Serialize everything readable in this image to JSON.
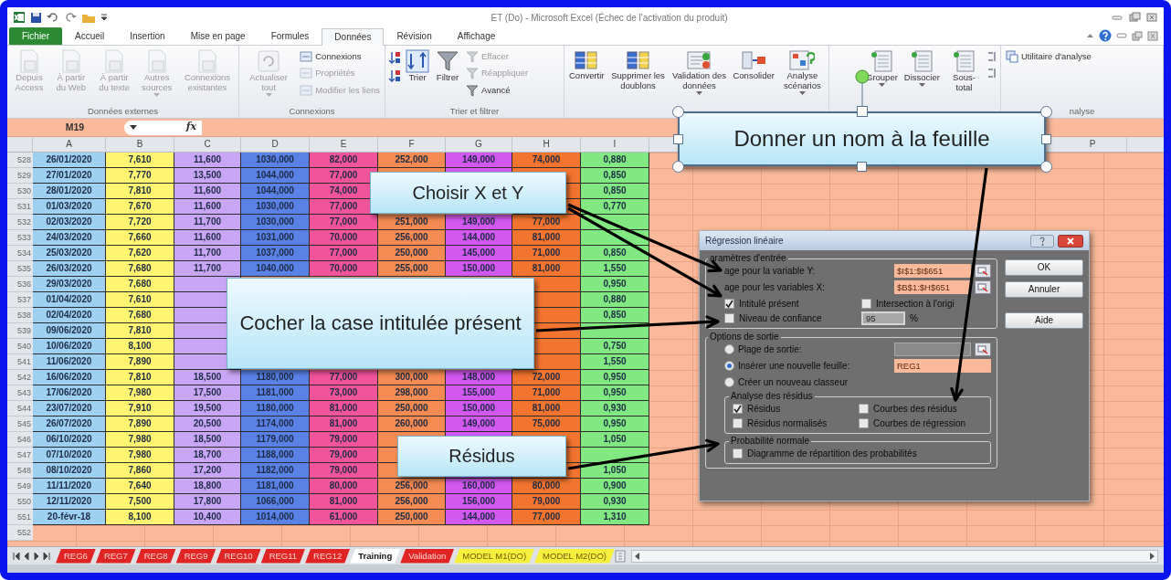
{
  "window": {
    "title": "ET (Do)  -  Microsoft Excel (Échec de l'activation du produit)"
  },
  "ribbon_tabs": [
    {
      "label": "Fichier",
      "kind": "file",
      "selected": false
    },
    {
      "label": "Accueil",
      "kind": "tab",
      "selected": false
    },
    {
      "label": "Insertion",
      "kind": "tab",
      "selected": false
    },
    {
      "label": "Mise en page",
      "kind": "tab",
      "selected": false
    },
    {
      "label": "Formules",
      "kind": "tab",
      "selected": false
    },
    {
      "label": "Données",
      "kind": "tab",
      "selected": true
    },
    {
      "label": "Révision",
      "kind": "tab",
      "selected": false
    },
    {
      "label": "Affichage",
      "kind": "tab",
      "selected": false
    }
  ],
  "ribbon_groups": [
    {
      "label": "Données externes",
      "buttons": [
        {
          "kind": "large",
          "label": "Depuis Access",
          "disabled": true
        },
        {
          "kind": "large",
          "label": "À partir du Web",
          "disabled": true
        },
        {
          "kind": "large",
          "label": "À partir du texte",
          "disabled": true
        },
        {
          "kind": "large",
          "label": "Autres sources",
          "disabled": true,
          "dropdown": true
        },
        {
          "kind": "large",
          "label": "Connexions existantes",
          "disabled": true
        }
      ]
    },
    {
      "label": "Connexions",
      "buttons": [
        {
          "kind": "large",
          "label": "Actualiser tout",
          "disabled": true,
          "dropdown": true
        },
        {
          "kind": "small",
          "label": "Connexions",
          "disabled": false
        },
        {
          "kind": "small",
          "label": "Propriétés",
          "disabled": true
        },
        {
          "kind": "small",
          "label": "Modifier les liens",
          "disabled": true
        }
      ]
    },
    {
      "label": "Trier et filtrer",
      "buttons": [
        {
          "kind": "icon",
          "disabled": false
        },
        {
          "kind": "icon",
          "disabled": false
        },
        {
          "kind": "large",
          "label": "Trier",
          "disabled": false
        },
        {
          "kind": "large",
          "label": "Filtrer",
          "disabled": false
        },
        {
          "kind": "small",
          "label": "Effacer",
          "disabled": true
        },
        {
          "kind": "small",
          "label": "Réappliquer",
          "disabled": true
        },
        {
          "kind": "small",
          "label": "Avancé",
          "disabled": false
        }
      ]
    },
    {
      "buttons": [
        {
          "kind": "large",
          "label": "Convertir",
          "disabled": false
        },
        {
          "kind": "large",
          "label": "Supprimer les doublons",
          "disabled": false
        },
        {
          "kind": "large",
          "label": "Validation des données",
          "disabled": false,
          "dropdown": true
        },
        {
          "kind": "large",
          "label": "Consolider",
          "disabled": false
        },
        {
          "kind": "large",
          "label": "Analyse scénarios",
          "disabled": false,
          "dropdown": true
        }
      ]
    },
    {
      "buttons": [
        {
          "kind": "large",
          "label": "Grouper",
          "disabled": false,
          "dropdown": true
        },
        {
          "kind": "large",
          "label": "Dissocier",
          "disabled": false,
          "dropdown": true
        },
        {
          "kind": "large",
          "label": "Sous-total",
          "disabled": false
        },
        {
          "kind": "icon",
          "disabled": false
        },
        {
          "kind": "icon",
          "disabled": false
        }
      ]
    },
    {
      "label": "nalyse",
      "buttons": [
        {
          "kind": "small",
          "label": "Utilitaire d'analyse",
          "disabled": false
        }
      ]
    }
  ],
  "formula_bar": {
    "name_box": "M19",
    "function_label": "fx"
  },
  "sheet": {
    "columns": [
      {
        "header": "A",
        "color": "#9ed0f2"
      },
      {
        "header": "B",
        "color": "#fff570"
      },
      {
        "header": "C",
        "color": "#c9a6f5"
      },
      {
        "header": "D",
        "color": "#5a82e6"
      },
      {
        "header": "E",
        "color": "#f2549c"
      },
      {
        "header": "F",
        "color": "#f58a52"
      },
      {
        "header": "G",
        "color": "#d258f0"
      },
      {
        "header": "H",
        "color": "#f2742f"
      },
      {
        "header": "I",
        "color": "#82e882"
      }
    ],
    "far_column_header": "P",
    "rows": [
      {
        "number": "528",
        "cells": [
          "26/01/2020",
          "7,610",
          "11,600",
          "1030,000",
          "82,000",
          "252,000",
          "149,000",
          "74,000",
          "0,880"
        ]
      },
      {
        "number": "529",
        "cells": [
          "27/01/2020",
          "7,770",
          "13,500",
          "1044,000",
          "77,000",
          null,
          null,
          null,
          "0,850"
        ]
      },
      {
        "number": "530",
        "cells": [
          "28/01/2020",
          "7,810",
          "11,600",
          "1044,000",
          "74,000",
          null,
          null,
          null,
          "0,850"
        ]
      },
      {
        "number": "531",
        "cells": [
          "01/03/2020",
          "7,670",
          "11,600",
          "1030,000",
          "77,000",
          null,
          null,
          null,
          "0,770"
        ]
      },
      {
        "number": "532",
        "cells": [
          "02/03/2020",
          "7,720",
          "11,700",
          "1030,000",
          "77,000",
          "251,000",
          "149,000",
          "77,000",
          null
        ]
      },
      {
        "number": "533",
        "cells": [
          "24/03/2020",
          "7,660",
          "11,600",
          "1031,000",
          "70,000",
          "256,000",
          "144,000",
          "81,000",
          null
        ]
      },
      {
        "number": "534",
        "cells": [
          "25/03/2020",
          "7,620",
          "11,700",
          "1037,000",
          "77,000",
          "250,000",
          "145,000",
          "71,000",
          "0,850"
        ]
      },
      {
        "number": "535",
        "cells": [
          "26/03/2020",
          "7,680",
          "11,700",
          "1040,000",
          "70,000",
          "255,000",
          "150,000",
          "81,000",
          "1,550"
        ]
      },
      {
        "number": "536",
        "cells": [
          "29/03/2020",
          "7,680",
          null,
          null,
          null,
          null,
          null,
          null,
          "0,950"
        ]
      },
      {
        "number": "537",
        "cells": [
          "01/04/2020",
          "7,610",
          null,
          null,
          null,
          null,
          null,
          null,
          "0,880"
        ]
      },
      {
        "number": "538",
        "cells": [
          "02/04/2020",
          "7,680",
          null,
          null,
          null,
          null,
          null,
          null,
          "0,850"
        ]
      },
      {
        "number": "539",
        "cells": [
          "09/06/2020",
          "7,810",
          null,
          null,
          null,
          null,
          null,
          null,
          null
        ]
      },
      {
        "number": "540",
        "cells": [
          "10/06/2020",
          "8,100",
          null,
          null,
          null,
          null,
          null,
          null,
          "0,750"
        ]
      },
      {
        "number": "541",
        "cells": [
          "11/06/2020",
          "7,890",
          null,
          null,
          null,
          null,
          null,
          null,
          "1,550"
        ]
      },
      {
        "number": "542",
        "cells": [
          "16/06/2020",
          "7,810",
          "18,500",
          "1180,000",
          "77,000",
          "300,000",
          "148,000",
          "72,000",
          "0,950"
        ]
      },
      {
        "number": "543",
        "cells": [
          "17/06/2020",
          "7,980",
          "17,500",
          "1181,000",
          "73,000",
          "298,000",
          "155,000",
          "71,000",
          "0,950"
        ]
      },
      {
        "number": "544",
        "cells": [
          "23/07/2020",
          "7,910",
          "19,500",
          "1180,000",
          "81,000",
          "250,000",
          "150,000",
          "81,000",
          "0,930"
        ]
      },
      {
        "number": "545",
        "cells": [
          "26/07/2020",
          "7,890",
          "20,500",
          "1174,000",
          "81,000",
          "260,000",
          "149,000",
          "75,000",
          "0,950"
        ]
      },
      {
        "number": "546",
        "cells": [
          "06/10/2020",
          "7,980",
          "18,500",
          "1179,000",
          "79,000",
          null,
          null,
          null,
          "1,050"
        ]
      },
      {
        "number": "547",
        "cells": [
          "07/10/2020",
          "7,980",
          "18,700",
          "1188,000",
          "79,000",
          null,
          null,
          null,
          null
        ]
      },
      {
        "number": "548",
        "cells": [
          "08/10/2020",
          "7,860",
          "17,200",
          "1182,000",
          "79,000",
          null,
          null,
          null,
          "1,050"
        ]
      },
      {
        "number": "549",
        "cells": [
          "11/11/2020",
          "7,640",
          "18,800",
          "1181,000",
          "80,000",
          "256,000",
          "160,000",
          "80,000",
          "0,900"
        ]
      },
      {
        "number": "550",
        "cells": [
          "12/11/2020",
          "7,500",
          "17,800",
          "1066,000",
          "81,000",
          "256,000",
          "156,000",
          "79,000",
          "0,930"
        ]
      },
      {
        "number": "551",
        "cells": [
          "20-févr-18",
          "8,100",
          "10,400",
          "1014,000",
          "61,000",
          "250,000",
          "144,000",
          "77,000",
          "1,310"
        ]
      },
      {
        "number": "552"
      }
    ]
  },
  "sheet_tabs": [
    {
      "label": "REG6",
      "color": "#e02424",
      "selected": false
    },
    {
      "label": "REG7",
      "color": "#e02424",
      "selected": false
    },
    {
      "label": "REG8",
      "color": "#e02424",
      "selected": false
    },
    {
      "label": "REG9",
      "color": "#e02424",
      "selected": false
    },
    {
      "label": "REG10",
      "color": "#e02424",
      "selected": false
    },
    {
      "label": "REG11",
      "color": "#e02424",
      "selected": false
    },
    {
      "label": "REG12",
      "color": "#e02424",
      "selected": false
    },
    {
      "label": "Training",
      "color": "#ffffff",
      "selected": true
    },
    {
      "label": "Validation",
      "color": "#e02424",
      "selected": false
    },
    {
      "label": "MODEL M1(DO)",
      "color": "#f5f03c",
      "selected": false
    },
    {
      "label": "MODEL M2(DO)",
      "color": "#f5f03c",
      "selected": false
    }
  ],
  "dialog": {
    "title": "Régression linéaire",
    "buttons": [
      "OK",
      "Annuler",
      "Aide"
    ],
    "input_group": {
      "legend": "aramètres d'entrée",
      "fields": [
        {
          "label": "age pour la variable Y:",
          "value": "$I$1:$I$651"
        },
        {
          "label": "age pour les variables X:",
          "value": "$B$1:$H$651"
        }
      ],
      "options": [
        {
          "label": "Intitulé présent",
          "checked": true
        },
        {
          "label": "Intersection à l'origi",
          "checked": false
        },
        {
          "label": "Niveau de confiance",
          "checked": false
        }
      ],
      "confidence": {
        "value": "95",
        "unit": "%"
      }
    },
    "output_group": {
      "legend": "Options de sortie",
      "choices": [
        {
          "label": "Plage de sortie:",
          "selected": false,
          "field": true
        },
        {
          "label": "Insérer une nouvelle feuille:",
          "selected": true,
          "field": true,
          "value": "REG1"
        },
        {
          "label": "Créer un nouveau classeur",
          "selected": false
        }
      ]
    },
    "residuals_group": {
      "legend": "Analyse des résidus",
      "options": [
        {
          "label": "Résidus",
          "checked": true
        },
        {
          "label": "Courbes des résidus",
          "checked": false
        },
        {
          "label": "Résidus normalisés",
          "checked": false
        },
        {
          "label": "Courbes de régression",
          "checked": false
        }
      ]
    },
    "probability_group": {
      "legend": "Probabilité normale",
      "options": [
        {
          "label": "Diagramme de répartition des probabilités",
          "checked": false
        }
      ]
    }
  },
  "callouts": [
    {
      "text": "Donner un nom à la feuille",
      "selected": true
    },
    {
      "text": "Choisir X et Y",
      "selected": false
    },
    {
      "text": "Cocher la case intitulée présent",
      "selected": false
    },
    {
      "text": "Résidus",
      "selected": false
    }
  ]
}
